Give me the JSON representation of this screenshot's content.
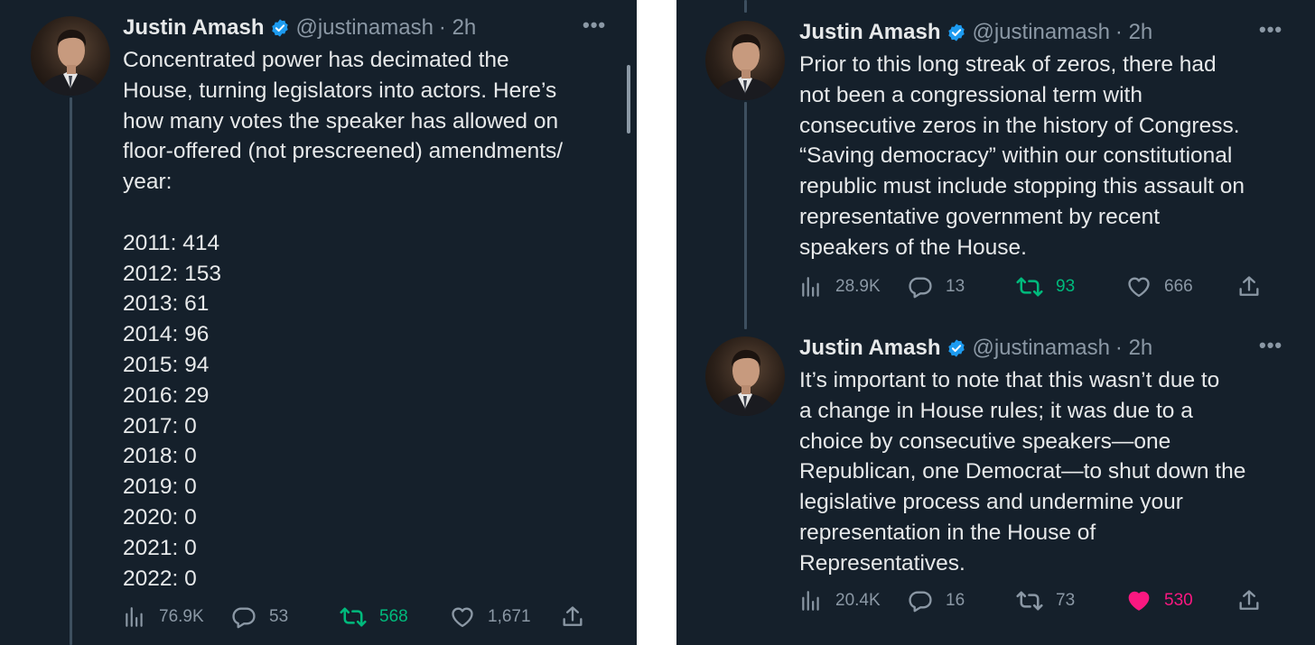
{
  "colors": {
    "background": "#15202b",
    "text": "#e7e9ea",
    "muted": "#8b98a5",
    "verified": "#1d9bf0",
    "retweeted": "#00ba7c",
    "liked": "#f91880"
  },
  "left": {
    "tweet": {
      "author_name": "Justin Amash",
      "handle": "@justinamash",
      "time": "· 2h",
      "body": "Concentrated power has decimated the\nHouse, turning legislators into actors. Here’s\nhow many votes the speaker has allowed on\nfloor-offered (not prescreened) amendments/\nyear:\n\n2011: 414\n2012: 153\n2013: 61\n2014: 96\n2015: 94\n2016: 29\n2017: 0\n2018: 0\n2019: 0\n2020: 0\n2021: 0\n2022: 0",
      "views": "76.9K",
      "replies": "53",
      "retweets": "568",
      "likes": "1,671",
      "retweeted": true,
      "liked": false
    }
  },
  "right": {
    "tweets": [
      {
        "author_name": "Justin Amash",
        "handle": "@justinamash",
        "time": "· 2h",
        "body": "Prior to this long streak of zeros, there had\nnot been a congressional term with\nconsecutive zeros in the history of Congress.\n“Saving democracy” within our constitutional\nrepublic must include stopping this assault on\nrepresentative government by recent\nspeakers of the House.",
        "views": "28.9K",
        "replies": "13",
        "retweets": "93",
        "likes": "666",
        "retweeted": true,
        "liked": false
      },
      {
        "author_name": "Justin Amash",
        "handle": "@justinamash",
        "time": "· 2h",
        "body": "It’s important to note that this wasn’t due to\na change in House rules; it was due to a\nchoice by consecutive speakers—one\nRepublican, one Democrat—to shut down the\nlegislative process and undermine your\nrepresentation in the House of\nRepresentatives.",
        "views": "20.4K",
        "replies": "16",
        "retweets": "73",
        "likes": "530",
        "retweeted": false,
        "liked": true
      }
    ]
  }
}
